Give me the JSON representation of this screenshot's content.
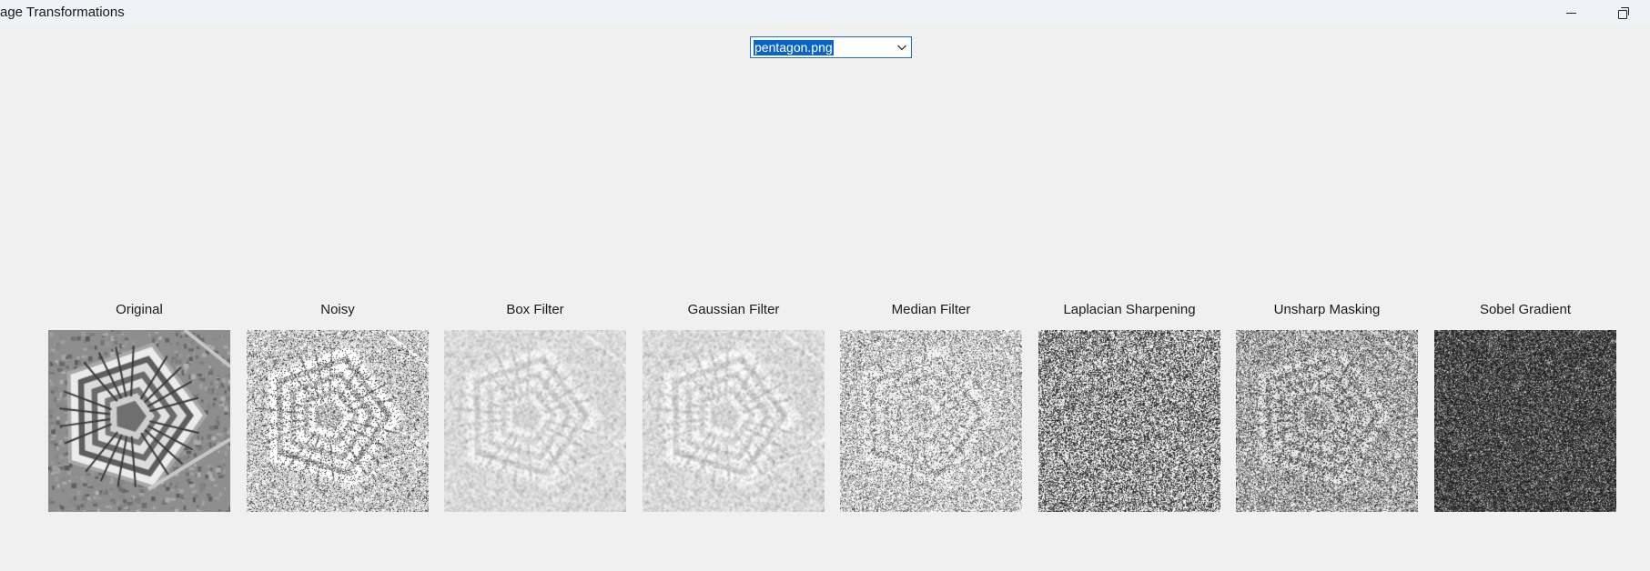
{
  "window": {
    "title": "age Transformations"
  },
  "image_select": {
    "value": "pentagon.png"
  },
  "panels": [
    {
      "label": "Original"
    },
    {
      "label": "Noisy"
    },
    {
      "label": "Box Filter"
    },
    {
      "label": "Gaussian Filter"
    },
    {
      "label": "Median Filter"
    },
    {
      "label": "Laplacian Sharpening"
    },
    {
      "label": "Unsharp Masking"
    },
    {
      "label": "Sobel Gradient"
    }
  ],
  "colors": {
    "background": "#f0f0f0",
    "titlebar": "#eff2f7",
    "selection": "#0a64c8",
    "focus_border": "#1b6ed1"
  },
  "icons": {
    "minimize": "minimize-icon",
    "restore": "restore-icon",
    "dropdown": "chevron-down-icon"
  }
}
